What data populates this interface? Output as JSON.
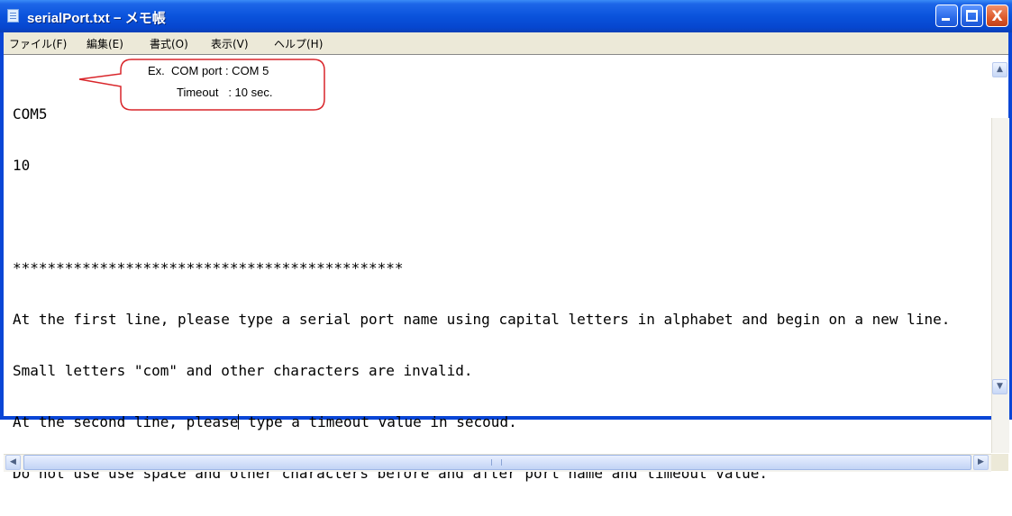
{
  "window": {
    "title": "serialPort.txt − メモ帳",
    "controls": {
      "minimize": "minimize",
      "maximize": "maximize",
      "close": "X"
    }
  },
  "menu": [
    "ファイル(F)",
    "編集(E)",
    "書式(O)",
    "表示(V)",
    "ヘルプ(H)"
  ],
  "document": {
    "lines": [
      "COM5",
      "10",
      "",
      "*********************************************",
      "At the first line, please type a serial port name using capital letters in alphabet and begin on a new line.",
      "Small letters \"com\" and other characters are invalid.",
      "At the second line, please",
      "Do not use use space and other characters before and after port name and timeout value."
    ],
    "line7_after_caret": " type a timeout value in secoud."
  },
  "callout": {
    "line1": "Ex.  COM port : COM 5",
    "line2": "Timeout   : 10 sec.",
    "border_color": "#d9252a"
  },
  "scrollbars": {
    "up": "▲",
    "down": "▼",
    "left": "◀",
    "right": "▶"
  }
}
